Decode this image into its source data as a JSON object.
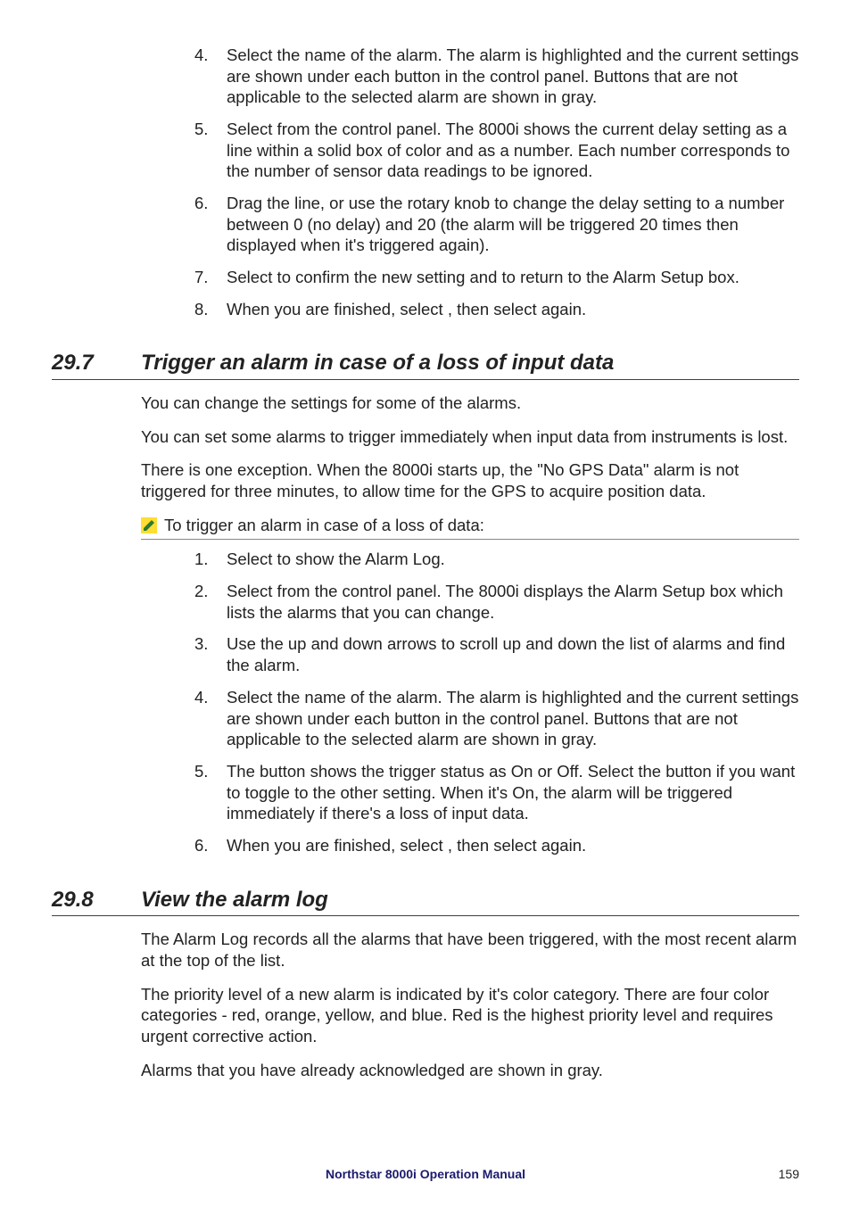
{
  "top_steps": [
    {
      "num": "4.",
      "text": "Select the name of the alarm. The alarm is highlighted and the current settings are shown under each button in the control panel. Buttons that are not applicable to the selected alarm are shown in gray."
    },
    {
      "num": "5.",
      "text": "Select                               from the control panel.  The 8000i shows the current delay setting as a line within a solid box of color and as a number. Each number corresponds to the number of sensor data readings to be ignored."
    },
    {
      "num": "6.",
      "text": "Drag the line, or use the rotary knob to change the delay setting to a number between 0 (no delay) and 20 (the alarm will be triggered 20 times then displayed when it's triggered again)."
    },
    {
      "num": "7.",
      "text": "Select          to confirm the new setting and to return to the Alarm Setup box."
    },
    {
      "num": "8.",
      "text": "When you are finished, select                    , then select                     again."
    }
  ],
  "sec297": {
    "num": "29.7",
    "title": "Trigger an alarm in case of a loss of input data",
    "p1": "You can change the settings for some of the alarms.",
    "p2": "You can set some alarms to trigger immediately when input data from instruments is lost.",
    "p3": "There is one exception. When the 8000i starts up, the \"No GPS Data\" alarm is not triggered for three minutes, to allow time for the GPS to acquire position data.",
    "task": "To trigger an alarm in case of a loss of data:",
    "steps": [
      {
        "num": "1.",
        "text": "Select                     to show the Alarm Log."
      },
      {
        "num": "2.",
        "text": "Select                                    from the control panel. The 8000i displays the Alarm Setup box which lists the alarms that you can change."
      },
      {
        "num": "3.",
        "text": "Use the up and down arrows to scroll up and down the list of alarms and find the alarm."
      },
      {
        "num": "4.",
        "text": "Select the name of the alarm. The alarm is highlighted and the current settings are shown under each button in the control panel. Buttons that are not applicable to the selected alarm are shown in gray."
      },
      {
        "num": "5.",
        "text": "The                                                button shows the trigger status as On or Off. Select the button if you want to toggle to the other setting. When it's On, the alarm will be triggered immediately if there's a loss of input data."
      },
      {
        "num": "6.",
        "text": "When you are finished, select                    , then select                     again."
      }
    ]
  },
  "sec298": {
    "num": "29.8",
    "title": "View the alarm log",
    "p1": "The Alarm Log records all the alarms that have been triggered, with the most recent alarm at the top of the list.",
    "p2": "The priority level of a new alarm is indicated by it's color category. There are four color categories - red, orange, yellow, and blue. Red is the highest priority level and requires urgent corrective action.",
    "p3": "Alarms that you have already acknowledged are shown in gray."
  },
  "footer": {
    "title": "Northstar 8000i Operation Manual",
    "page": "159"
  }
}
